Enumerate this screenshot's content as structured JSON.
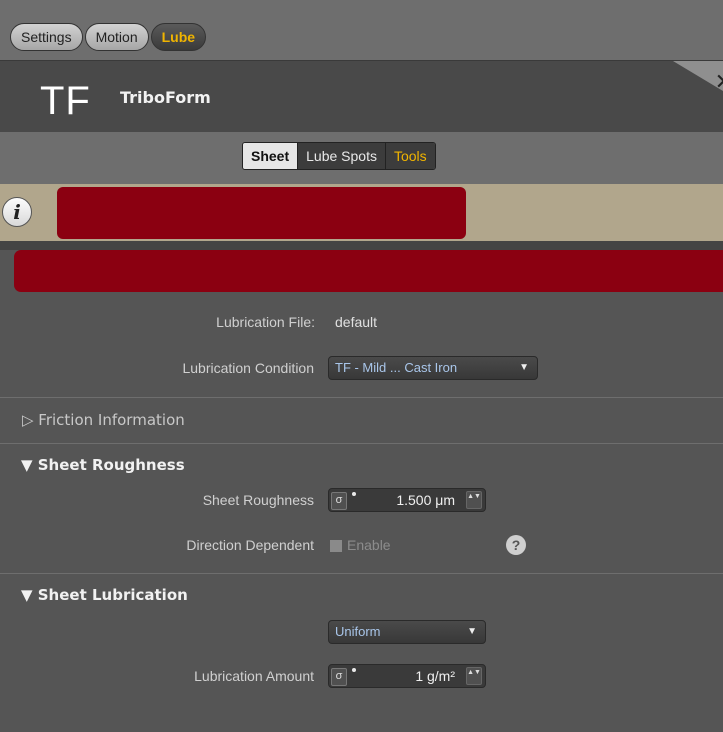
{
  "top_tabs": {
    "settings": "Settings",
    "motion": "Motion",
    "lube": "Lube"
  },
  "header": {
    "logo": "TF",
    "title": "TriboForm",
    "close": "✕"
  },
  "sub_tabs": {
    "sheet": "Sheet",
    "lube_spots": "Lube Spots",
    "tools": "Tools"
  },
  "info": {
    "icon": "i"
  },
  "lubrication": {
    "file_label": "Lubrication File:",
    "file_value": "default",
    "condition_label": "Lubrication Condition",
    "condition_value": "TF - Mild ... Cast Iron"
  },
  "friction": {
    "title": "▷ Friction Information"
  },
  "sheet_roughness": {
    "title": "▼ Sheet Roughness",
    "roughness_label": "Sheet Roughness",
    "roughness_value": "1.500 μm",
    "direction_label": "Direction Dependent",
    "enable_label": "Enable",
    "help": "?"
  },
  "sheet_lubrication": {
    "title": "▼ Sheet Lubrication",
    "distribution_value": "Uniform",
    "amount_label": "Lubrication Amount",
    "amount_value": "1 g/m²"
  },
  "icons": {
    "sigma": "σ",
    "spin": "▲▼",
    "dropdown": "▼"
  },
  "colors": {
    "accent": "#f0b400",
    "error": "#8b0011",
    "info_bg": "#b1a68c",
    "panel": "#555555",
    "dropdown_text": "#a9c6ea"
  }
}
